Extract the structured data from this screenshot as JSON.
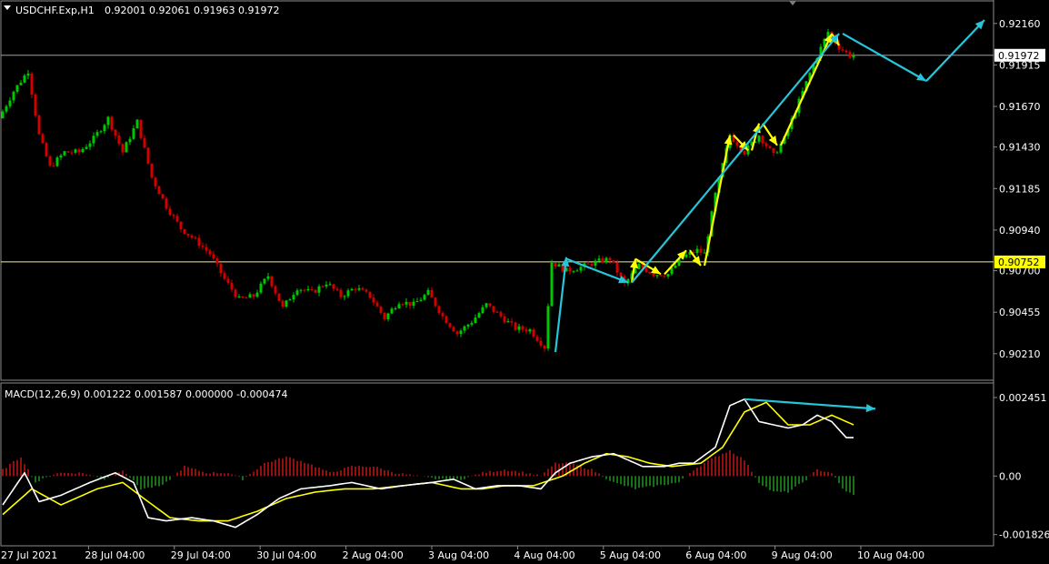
{
  "header": {
    "symbol": "USDCHF.Exp,H1",
    "ohlc": "0.92001 0.92061 0.91963 0.91972"
  },
  "macd_header": {
    "label": "MACD(12,26,9) 0.001222 0.001587 0.000000 -0.000474"
  },
  "colors": {
    "background": "#000000",
    "bull": "#00c800",
    "bear": "#d40000",
    "hist_pos": "#b81414",
    "hist_neg": "#1e8c1e",
    "macd_line": "#ffffff",
    "signal_line": "#ffff00",
    "arrow_cyan": "#26c6da",
    "arrow_yellow": "#ffff00",
    "border": "#8c8c8c"
  },
  "chart_data": [
    {
      "type": "candlestick",
      "title": "USDCHF.Exp,H1",
      "price_ticks": [
        "0.92160",
        "0.91915",
        "0.91670",
        "0.91430",
        "0.91185",
        "0.90940",
        "0.90700",
        "0.90455",
        "0.90210"
      ],
      "ylim": [
        0.9015,
        0.9225
      ],
      "current_price": "0.91972",
      "yellow_level": "0.90752",
      "x_labels": [
        "27 Jul 2021",
        "28 Jul 04:00",
        "29 Jul 04:00",
        "30 Jul 04:00",
        "2 Aug 04:00",
        "3 Aug 04:00",
        "4 Aug 04:00",
        "5 Aug 04:00",
        "6 Aug 04:00",
        "9 Aug 04:00",
        "10 Aug 04:00"
      ],
      "candle_count": 235,
      "price_path": [
        [
          0,
          0.916
        ],
        [
          4,
          0.9176
        ],
        [
          8,
          0.9188
        ],
        [
          11,
          0.915
        ],
        [
          14,
          0.9131
        ],
        [
          18,
          0.914
        ],
        [
          22,
          0.914
        ],
        [
          26,
          0.9148
        ],
        [
          30,
          0.916
        ],
        [
          34,
          0.914
        ],
        [
          38,
          0.9158
        ],
        [
          42,
          0.9125
        ],
        [
          46,
          0.9108
        ],
        [
          50,
          0.9095
        ],
        [
          54,
          0.9088
        ],
        [
          58,
          0.908
        ],
        [
          62,
          0.9065
        ],
        [
          66,
          0.9053
        ],
        [
          70,
          0.9055
        ],
        [
          74,
          0.9067
        ],
        [
          78,
          0.9048
        ],
        [
          82,
          0.906
        ],
        [
          86,
          0.9057
        ],
        [
          90,
          0.9063
        ],
        [
          94,
          0.9055
        ],
        [
          98,
          0.906
        ],
        [
          102,
          0.9055
        ],
        [
          106,
          0.9042
        ],
        [
          110,
          0.9052
        ],
        [
          114,
          0.905
        ],
        [
          118,
          0.9057
        ],
        [
          122,
          0.9043
        ],
        [
          126,
          0.9033
        ],
        [
          130,
          0.904
        ],
        [
          134,
          0.905
        ],
        [
          138,
          0.9043
        ],
        [
          142,
          0.9036
        ],
        [
          146,
          0.9035
        ],
        [
          150,
          0.9025
        ],
        [
          152,
          0.9075
        ],
        [
          156,
          0.907
        ],
        [
          160,
          0.9072
        ],
        [
          164,
          0.9075
        ],
        [
          168,
          0.9077
        ],
        [
          172,
          0.9062
        ],
        [
          176,
          0.9073
        ],
        [
          180,
          0.9068
        ],
        [
          184,
          0.9068
        ],
        [
          188,
          0.9078
        ],
        [
          192,
          0.9082
        ],
        [
          194,
          0.908
        ],
        [
          197,
          0.9115
        ],
        [
          201,
          0.915
        ],
        [
          205,
          0.914
        ],
        [
          209,
          0.915
        ],
        [
          213,
          0.9138
        ],
        [
          216,
          0.9148
        ],
        [
          220,
          0.917
        ],
        [
          224,
          0.9192
        ],
        [
          228,
          0.9211
        ],
        [
          231,
          0.9202
        ],
        [
          234,
          0.9197
        ]
      ]
    },
    {
      "type": "macd",
      "title": "MACD(12,26,9)",
      "ticks": [
        "0.002451",
        "0.00",
        "-0.001826"
      ],
      "ylim": [
        -0.00195,
        0.00265
      ],
      "macd_path": [
        [
          0,
          -0.0009
        ],
        [
          6,
          0.0001
        ],
        [
          10,
          -0.0008
        ],
        [
          16,
          -0.0006
        ],
        [
          24,
          -0.0002
        ],
        [
          31,
          0.0001
        ],
        [
          36,
          -0.0002
        ],
        [
          40,
          -0.0013
        ],
        [
          45,
          -0.0014
        ],
        [
          52,
          -0.0013
        ],
        [
          58,
          -0.0014
        ],
        [
          64,
          -0.0016
        ],
        [
          70,
          -0.0012
        ],
        [
          76,
          -0.0007
        ],
        [
          82,
          -0.0004
        ],
        [
          90,
          -0.0003
        ],
        [
          96,
          -0.0002
        ],
        [
          104,
          -0.0004
        ],
        [
          110,
          -0.0003
        ],
        [
          118,
          -0.0002
        ],
        [
          124,
          -0.0001
        ],
        [
          130,
          -0.0004
        ],
        [
          136,
          -0.0003
        ],
        [
          142,
          -0.0003
        ],
        [
          148,
          -0.0004
        ],
        [
          152,
          0.0001
        ],
        [
          156,
          0.0004
        ],
        [
          162,
          0.0006
        ],
        [
          168,
          0.0007
        ],
        [
          172,
          0.0005
        ],
        [
          176,
          0.0003
        ],
        [
          182,
          0.0003
        ],
        [
          186,
          0.0004
        ],
        [
          190,
          0.0004
        ],
        [
          196,
          0.0009
        ],
        [
          200,
          0.0022
        ],
        [
          204,
          0.0024
        ],
        [
          208,
          0.0017
        ],
        [
          212,
          0.0016
        ],
        [
          216,
          0.0015
        ],
        [
          220,
          0.0016
        ],
        [
          224,
          0.0019
        ],
        [
          228,
          0.0017
        ],
        [
          232,
          0.0012
        ]
      ],
      "signal_path": [
        [
          0,
          -0.0012
        ],
        [
          8,
          -0.0004
        ],
        [
          16,
          -0.0009
        ],
        [
          26,
          -0.0004
        ],
        [
          33,
          -0.0002
        ],
        [
          40,
          -0.0008
        ],
        [
          46,
          -0.0013
        ],
        [
          54,
          -0.0014
        ],
        [
          62,
          -0.0014
        ],
        [
          70,
          -0.0011
        ],
        [
          78,
          -0.0007
        ],
        [
          86,
          -0.0005
        ],
        [
          94,
          -0.0004
        ],
        [
          102,
          -0.0004
        ],
        [
          110,
          -0.0003
        ],
        [
          118,
          -0.0002
        ],
        [
          126,
          -0.0004
        ],
        [
          132,
          -0.0004
        ],
        [
          138,
          -0.0003
        ],
        [
          146,
          -0.0003
        ],
        [
          154,
          0.0
        ],
        [
          160,
          0.0004
        ],
        [
          166,
          0.0007
        ],
        [
          172,
          0.0006
        ],
        [
          178,
          0.0004
        ],
        [
          184,
          0.0003
        ],
        [
          192,
          0.0004
        ],
        [
          198,
          0.0009
        ],
        [
          204,
          0.002
        ],
        [
          210,
          0.0023
        ],
        [
          216,
          0.0016
        ],
        [
          222,
          0.0016
        ],
        [
          228,
          0.0019
        ],
        [
          234,
          0.0016
        ]
      ],
      "hist_path": [
        [
          0,
          0.0002
        ],
        [
          5,
          0.0006
        ],
        [
          9,
          -0.0002
        ],
        [
          15,
          0.0001
        ],
        [
          22,
          0.0001
        ],
        [
          28,
          -0.0001
        ],
        [
          33,
          0.0002
        ],
        [
          38,
          -0.0004
        ],
        [
          44,
          -0.0003
        ],
        [
          50,
          0.0003
        ],
        [
          56,
          0.0001
        ],
        [
          62,
          0.0001
        ],
        [
          66,
          -0.0001
        ],
        [
          72,
          0.0004
        ],
        [
          78,
          0.0006
        ],
        [
          84,
          0.0004
        ],
        [
          90,
          0.0001
        ],
        [
          96,
          0.0003
        ],
        [
          102,
          0.0003
        ],
        [
          108,
          0.0001
        ],
        [
          114,
          0.0
        ],
        [
          120,
          -0.0001
        ],
        [
          126,
          -0.0001
        ],
        [
          132,
          0.0001
        ],
        [
          138,
          0.0002
        ],
        [
          144,
          0.0001
        ],
        [
          148,
          0.0
        ],
        [
          152,
          0.0004
        ],
        [
          156,
          0.0004
        ],
        [
          162,
          0.0002
        ],
        [
          168,
          -0.0002
        ],
        [
          174,
          -0.0004
        ],
        [
          180,
          -0.0003
        ],
        [
          186,
          -0.0002
        ],
        [
          190,
          0.0002
        ],
        [
          196,
          0.0006
        ],
        [
          200,
          0.0008
        ],
        [
          204,
          0.0005
        ],
        [
          208,
          -0.0002
        ],
        [
          212,
          -0.0005
        ],
        [
          216,
          -0.0005
        ],
        [
          220,
          -0.0002
        ],
        [
          224,
          0.0002
        ],
        [
          228,
          0.0001
        ],
        [
          231,
          -0.0004
        ],
        [
          234,
          -0.0006
        ]
      ]
    }
  ],
  "annotations": {
    "cyan_arrows": [
      [
        [
          152,
          0.9022
        ],
        [
          155,
          0.9078
        ]
      ],
      [
        [
          155,
          0.9077
        ],
        [
          172,
          0.9063
        ]
      ],
      [
        [
          173,
          0.9063
        ],
        [
          230,
          0.921
        ]
      ],
      [
        [
          231,
          0.921
        ],
        [
          254,
          0.9182
        ]
      ],
      [
        [
          254,
          0.9182
        ],
        [
          270,
          0.9218
        ]
      ]
    ],
    "yellow_arrows": [
      [
        [
          173,
          0.9063
        ],
        [
          174,
          0.9077
        ]
      ],
      [
        [
          174,
          0.9077
        ],
        [
          181,
          0.9068
        ]
      ],
      [
        [
          182,
          0.9068
        ],
        [
          188,
          0.9082
        ]
      ],
      [
        [
          189,
          0.9082
        ],
        [
          192,
          0.9073
        ]
      ],
      [
        [
          193,
          0.9073
        ],
        [
          200,
          0.915
        ]
      ],
      [
        [
          201,
          0.915
        ],
        [
          205,
          0.9141
        ]
      ],
      [
        [
          206,
          0.9141
        ],
        [
          208,
          0.9157
        ]
      ],
      [
        [
          209,
          0.9157
        ],
        [
          213,
          0.9144
        ]
      ],
      [
        [
          214,
          0.9144
        ],
        [
          228,
          0.921
        ]
      ],
      [
        [
          228,
          0.921
        ],
        [
          230,
          0.9203
        ]
      ]
    ],
    "macd_arrow": [
      [
        204,
        0.0024
      ],
      [
        240,
        0.0021
      ]
    ]
  }
}
